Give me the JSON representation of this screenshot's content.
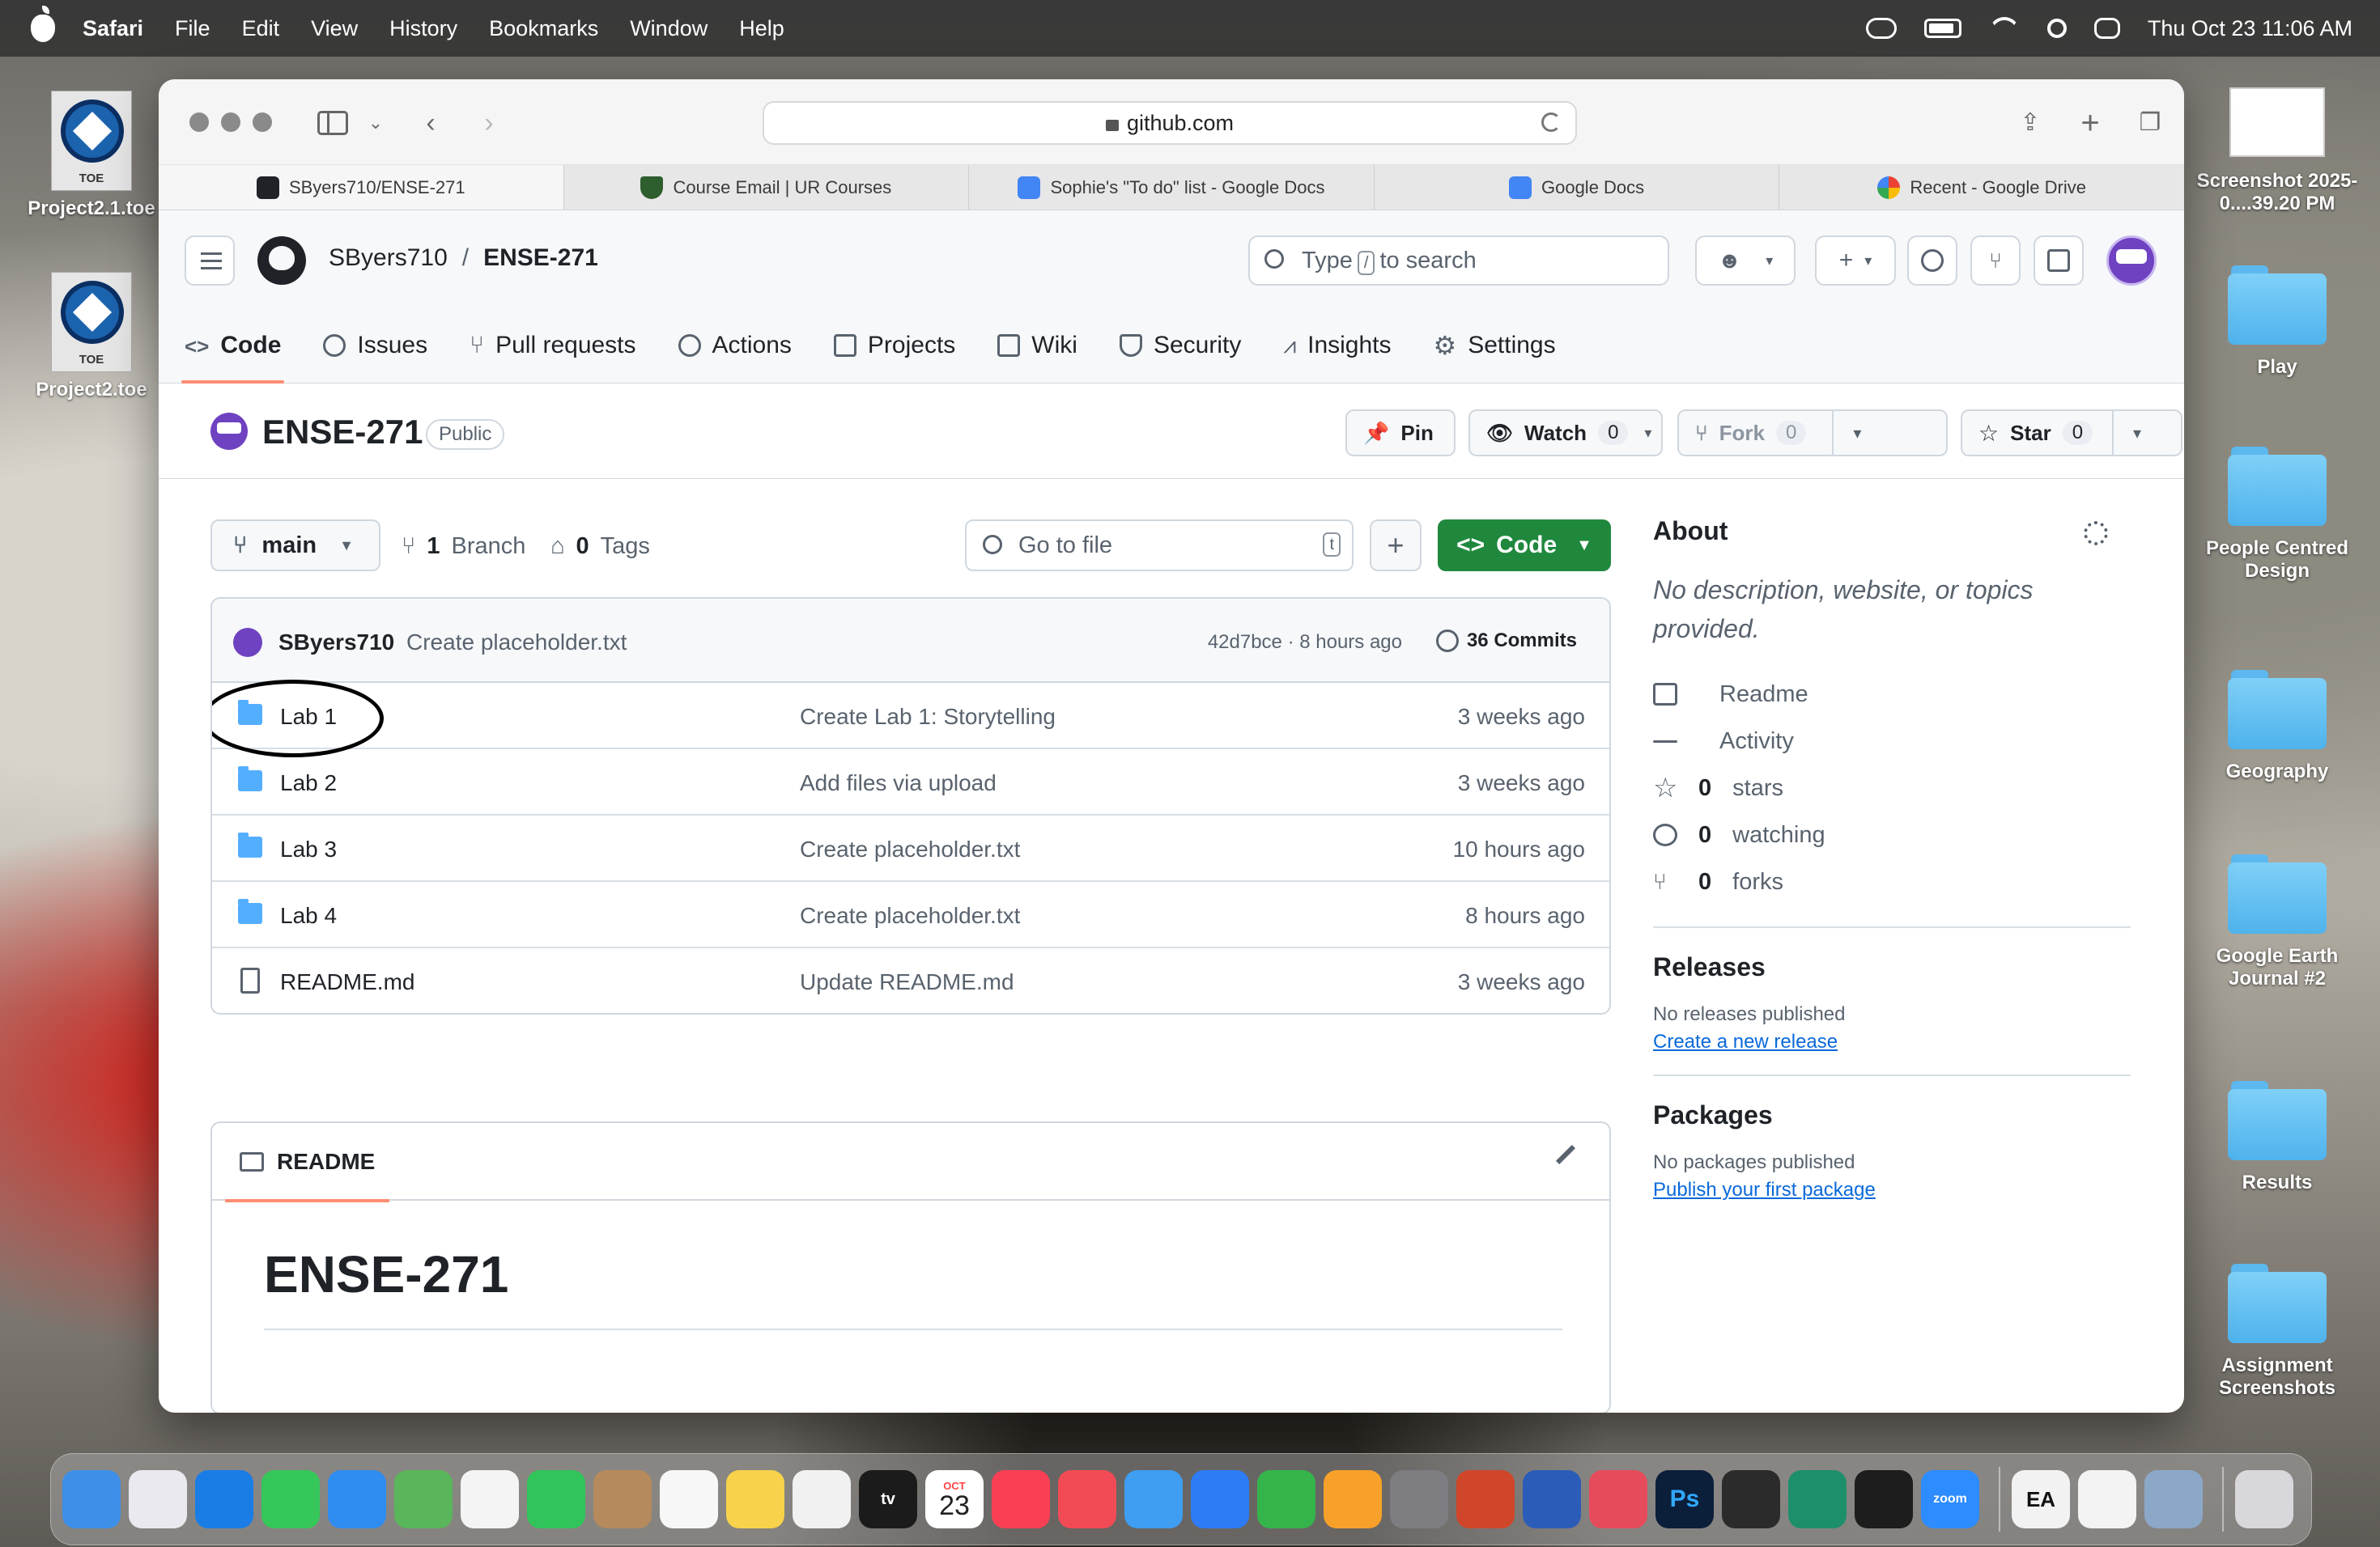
{
  "menubar": {
    "app": "Safari",
    "items": [
      "File",
      "Edit",
      "View",
      "History",
      "Bookmarks",
      "Window",
      "Help"
    ],
    "clock": "Thu Oct 23  11:06 AM"
  },
  "desktop": {
    "left_icons": [
      {
        "label": "Project2.1.toe",
        "badge": "TOE"
      },
      {
        "label": "Project2.toe",
        "badge": "TOE"
      }
    ],
    "right_icons": [
      {
        "label": "Screenshot 2025-0....39.20 PM",
        "kind": "screenshot"
      },
      {
        "label": "Play",
        "kind": "folder"
      },
      {
        "label": "People Centred Design",
        "kind": "folder"
      },
      {
        "label": "Geography",
        "kind": "folder"
      },
      {
        "label": "Google Earth Journal #2",
        "kind": "folder"
      },
      {
        "label": "Results",
        "kind": "folder"
      },
      {
        "label": "Assignment Screenshots",
        "kind": "folder"
      }
    ]
  },
  "browser": {
    "address": "github.com",
    "tabs": [
      {
        "label": "SByers710/ENSE-271",
        "icon": "github-icon",
        "active": true
      },
      {
        "label": "Course Email | UR Courses",
        "icon": "shield-icon",
        "active": false
      },
      {
        "label": "Sophie's \"To do\" list - Google Docs",
        "icon": "docs-icon",
        "active": false
      },
      {
        "label": "Google Docs",
        "icon": "docs-icon",
        "active": false
      },
      {
        "label": "Recent - Google Drive",
        "icon": "google-icon",
        "active": false
      }
    ]
  },
  "github": {
    "owner": "SByers710",
    "repo": "ENSE-271",
    "search_placeholder_pre": "Type",
    "search_key": "/",
    "search_placeholder_post": "to search",
    "nav": [
      {
        "label": "Code",
        "icon": "code-icon",
        "active": true
      },
      {
        "label": "Issues",
        "icon": "issue-icon"
      },
      {
        "label": "Pull requests",
        "icon": "pull-request-icon"
      },
      {
        "label": "Actions",
        "icon": "play-icon"
      },
      {
        "label": "Projects",
        "icon": "table-icon"
      },
      {
        "label": "Wiki",
        "icon": "book-icon"
      },
      {
        "label": "Security",
        "icon": "shield-icon"
      },
      {
        "label": "Insights",
        "icon": "graph-icon"
      },
      {
        "label": "Settings",
        "icon": "gear-icon"
      }
    ],
    "visibility": "Public",
    "actions": {
      "pin": "Pin",
      "watch": "Watch",
      "watch_count": "0",
      "fork": "Fork",
      "fork_count": "0",
      "star": "Star",
      "star_count": "0"
    },
    "branch": "main",
    "branch_count": "1",
    "branch_label": "Branch",
    "tag_count": "0",
    "tag_label": "Tags",
    "go_to_file": "Go to file",
    "go_to_file_key": "t",
    "code_button": "Code",
    "latest_commit": {
      "author": "SByers710",
      "message": "Create placeholder.txt",
      "hash_time": "42d7bce · 8 hours ago",
      "commits": "36 Commits"
    },
    "files": [
      {
        "name": "Lab 1",
        "type": "dir",
        "message": "Create Lab 1: Storytelling",
        "date": "3 weeks ago"
      },
      {
        "name": "Lab 2",
        "type": "dir",
        "message": "Add files via upload",
        "date": "3 weeks ago"
      },
      {
        "name": "Lab 3",
        "type": "dir",
        "message": "Create placeholder.txt",
        "date": "10 hours ago"
      },
      {
        "name": "Lab 4",
        "type": "dir",
        "message": "Create placeholder.txt",
        "date": "8 hours ago"
      },
      {
        "name": "README.md",
        "type": "file",
        "message": "Update README.md",
        "date": "3 weeks ago"
      }
    ],
    "readme": {
      "tab": "README",
      "heading": "ENSE-271"
    },
    "about": {
      "title": "About",
      "description": "No description, website, or topics provided.",
      "items": [
        {
          "count": "",
          "label": "Readme",
          "icon": "book-icon"
        },
        {
          "count": "",
          "label": "Activity",
          "icon": "pulse-icon"
        },
        {
          "count": "0",
          "label": "stars",
          "icon": "star-icon"
        },
        {
          "count": "0",
          "label": "watching",
          "icon": "eye-icon"
        },
        {
          "count": "0",
          "label": "forks",
          "icon": "fork-icon"
        }
      ],
      "releases_title": "Releases",
      "releases_text": "No releases published",
      "releases_link": "Create a new release",
      "packages_title": "Packages",
      "packages_text": "No packages published",
      "packages_link": "Publish your first package"
    }
  },
  "dock": {
    "apps": [
      {
        "name": "finder",
        "color": "#3d8fe8"
      },
      {
        "name": "launchpad",
        "color": "#e9e9ef"
      },
      {
        "name": "safari",
        "color": "#1a7de6"
      },
      {
        "name": "messages",
        "color": "#35c759"
      },
      {
        "name": "mail",
        "color": "#2f8cf0"
      },
      {
        "name": "maps",
        "color": "#5ab65a"
      },
      {
        "name": "photos",
        "color": "#f4f4f4"
      },
      {
        "name": "facetime",
        "color": "#31c45a"
      },
      {
        "name": "contacts",
        "color": "#b58a5c"
      },
      {
        "name": "reminders",
        "color": "#f7f7f7"
      },
      {
        "name": "notes",
        "color": "#f7d24a"
      },
      {
        "name": "freeform",
        "color": "#f1f1f1"
      },
      {
        "name": "tv",
        "color": "#1b1b1b"
      },
      {
        "name": "calendar",
        "color": "#ffffff"
      },
      {
        "name": "music",
        "color": "#fa3f55"
      },
      {
        "name": "news",
        "color": "#f24b55"
      },
      {
        "name": "weather",
        "color": "#3f9df2"
      },
      {
        "name": "keynote",
        "color": "#2d7cf6"
      },
      {
        "name": "numbers",
        "color": "#35b44b"
      },
      {
        "name": "pages",
        "color": "#f7a12a"
      },
      {
        "name": "system-settings",
        "color": "#7d7d82"
      },
      {
        "name": "powerpoint",
        "color": "#d0462b"
      },
      {
        "name": "word",
        "color": "#2b5cb8"
      },
      {
        "name": "creative-cloud",
        "color": "#e64b5b"
      },
      {
        "name": "photoshop",
        "color": "#0b1f3a"
      },
      {
        "name": "touchdesigner",
        "color": "#2b2b2b"
      },
      {
        "name": "perplexity",
        "color": "#1e8f6b"
      },
      {
        "name": "figma",
        "color": "#1d1d1d"
      },
      {
        "name": "zoom",
        "color": "#2d8cff"
      },
      {
        "name": "ea",
        "color": "#f2f2f2"
      },
      {
        "name": "textedit",
        "color": "#f3f3f3"
      },
      {
        "name": "preview",
        "color": "#8ca8c8"
      },
      {
        "name": "trash",
        "color": "#d8d8dc"
      }
    ],
    "calendar_month": "OCT",
    "calendar_day": "23",
    "tv_label": "tv",
    "ps_label": "Ps",
    "zoom_label": "zoom",
    "ea_label": "EA"
  }
}
